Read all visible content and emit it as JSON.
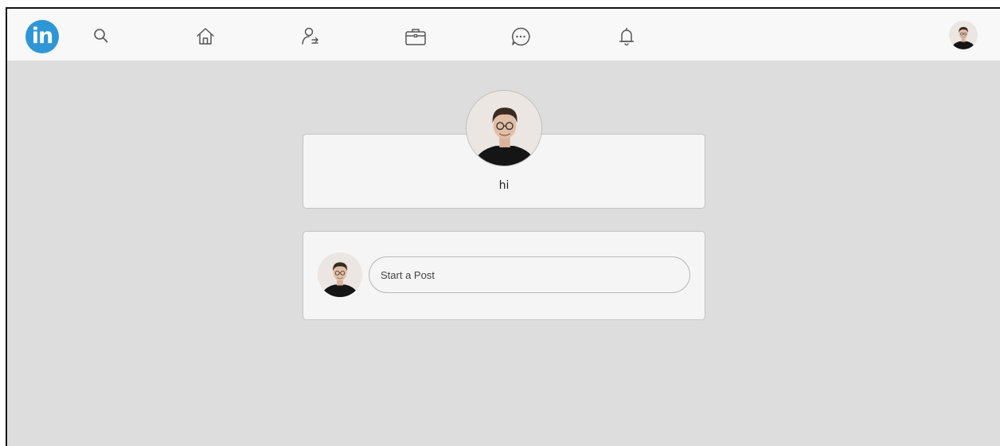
{
  "navbar": {
    "logo_text": "in",
    "icons": [
      "search-icon",
      "home-icon",
      "network-icon",
      "jobs-icon",
      "messaging-icon",
      "notifications-icon"
    ]
  },
  "profile": {
    "name": "hi"
  },
  "post": {
    "placeholder": "Start a Post"
  },
  "colors": {
    "brand": "#2f96d6",
    "background": "#dddddd",
    "navbar": "#f8f8f8",
    "card": "#f5f5f5",
    "border": "#c4c4c4"
  }
}
